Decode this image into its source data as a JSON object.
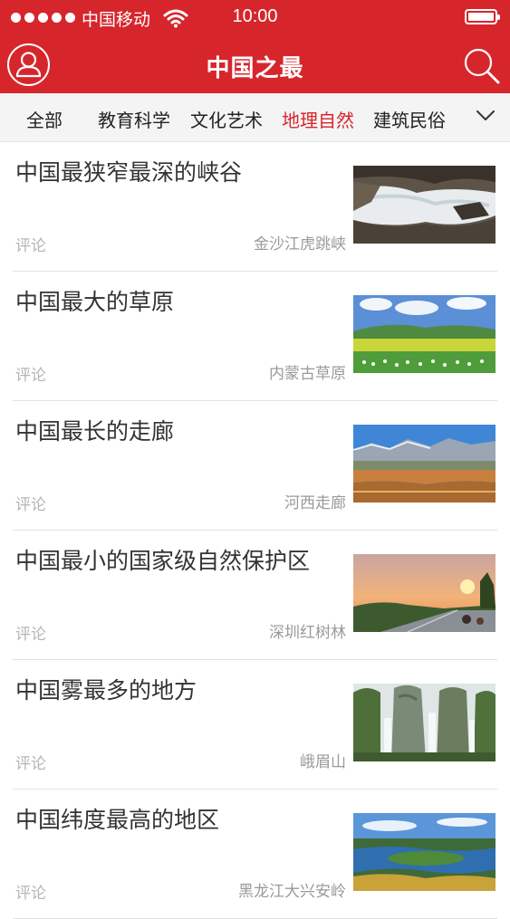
{
  "status_bar": {
    "carrier": "中国移动",
    "time": "10:00"
  },
  "header": {
    "title": "中国之最",
    "left_icon": "user-icon",
    "right_icon": "search-icon"
  },
  "tabs": [
    {
      "label": "全部",
      "active": false
    },
    {
      "label": "教育科学",
      "active": false
    },
    {
      "label": "文化艺术",
      "active": false
    },
    {
      "label": "地理自然",
      "active": true
    },
    {
      "label": "建筑民俗",
      "active": false
    }
  ],
  "tabs_more_icon": "chevron-down-icon",
  "articles": [
    {
      "title": "中国最狭窄最深的峡谷",
      "comment_label": "评论",
      "place": "金沙江虎跳峡",
      "image": "canyon-river"
    },
    {
      "title": "中国最大的草原",
      "comment_label": "评论",
      "place": "内蒙古草原",
      "image": "grassland-sheep"
    },
    {
      "title": "中国最长的走廊",
      "comment_label": "评论",
      "place": "河西走廊",
      "image": "mountain-corridor"
    },
    {
      "title": "中国最小的国家级自然保护区",
      "comment_label": "评论",
      "place": "深圳红树林",
      "image": "sunset-coast"
    },
    {
      "title": "中国雾最多的地方",
      "comment_label": "评论",
      "place": "峨眉山",
      "image": "waterfall-cliffs"
    },
    {
      "title": "中国纬度最高的地区",
      "comment_label": "评论",
      "place": "黑龙江大兴安岭",
      "image": "river-bend"
    }
  ],
  "colors": {
    "brand_red": "#d6262c",
    "active_tab": "#d6262c"
  }
}
